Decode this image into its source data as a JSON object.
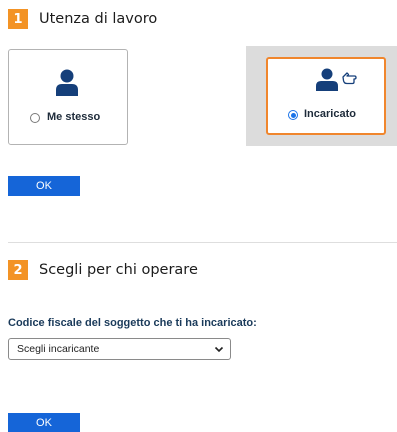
{
  "section1": {
    "step": "1",
    "title": "Utenza di lavoro",
    "options": [
      {
        "label": "Me stesso",
        "selected": false,
        "icon": "person-icon"
      },
      {
        "label": "Incaricato",
        "selected": true,
        "icon": "person-with-pointing-hand-icon"
      }
    ],
    "ok_label": "OK"
  },
  "section2": {
    "step": "2",
    "title": "Scegli per chi operare",
    "field_label": "Codice fiscale del soggetto che ti ha incaricato:",
    "select_value": "Scegli incaricante",
    "ok_label": "OK"
  },
  "colors": {
    "accent_orange": "#f39325",
    "button_blue": "#1565d8",
    "icon_navy": "#153f7a",
    "radio_blue": "#1a73e8"
  }
}
